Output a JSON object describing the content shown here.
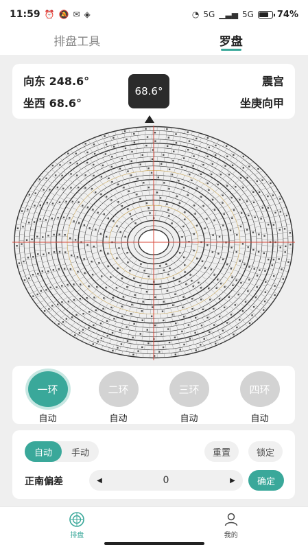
{
  "status_bar": {
    "time": "11:59",
    "network_5g_1": "5G",
    "network_5g_2": "5G",
    "battery_percent_label": "74%",
    "battery_level": 0.74
  },
  "tabs": [
    {
      "label": "排盘工具",
      "active": false
    },
    {
      "label": "罗盘",
      "active": true
    }
  ],
  "heading": {
    "facing": "向东 248.6°",
    "sitting": "坐西 68.6°",
    "degree_badge": "68.6°",
    "palace": "震宫",
    "mountain": "坐庚向甲"
  },
  "rings": [
    {
      "label": "一环",
      "mode": "自动",
      "active": true
    },
    {
      "label": "二环",
      "mode": "自动",
      "active": false
    },
    {
      "label": "三环",
      "mode": "自动",
      "active": false
    },
    {
      "label": "四环",
      "mode": "自动",
      "active": false
    }
  ],
  "controls": {
    "auto_label": "自动",
    "manual_label": "手动",
    "reset_label": "重置",
    "lock_label": "锁定",
    "offset_label": "正南偏差",
    "offset_value": "0",
    "decrease_symbol": "◀",
    "increase_symbol": "▶",
    "confirm_label": "确定"
  },
  "bottom_nav": [
    {
      "label": "排盘",
      "icon": "compass-icon",
      "active": true
    },
    {
      "label": "我的",
      "icon": "user-icon",
      "active": false
    }
  ],
  "colors": {
    "accent": "#3aa89a",
    "inactive_ring": "#d3d3d3",
    "badge_bg": "#2b2b2b",
    "compass_red_line": "#d9473a"
  }
}
